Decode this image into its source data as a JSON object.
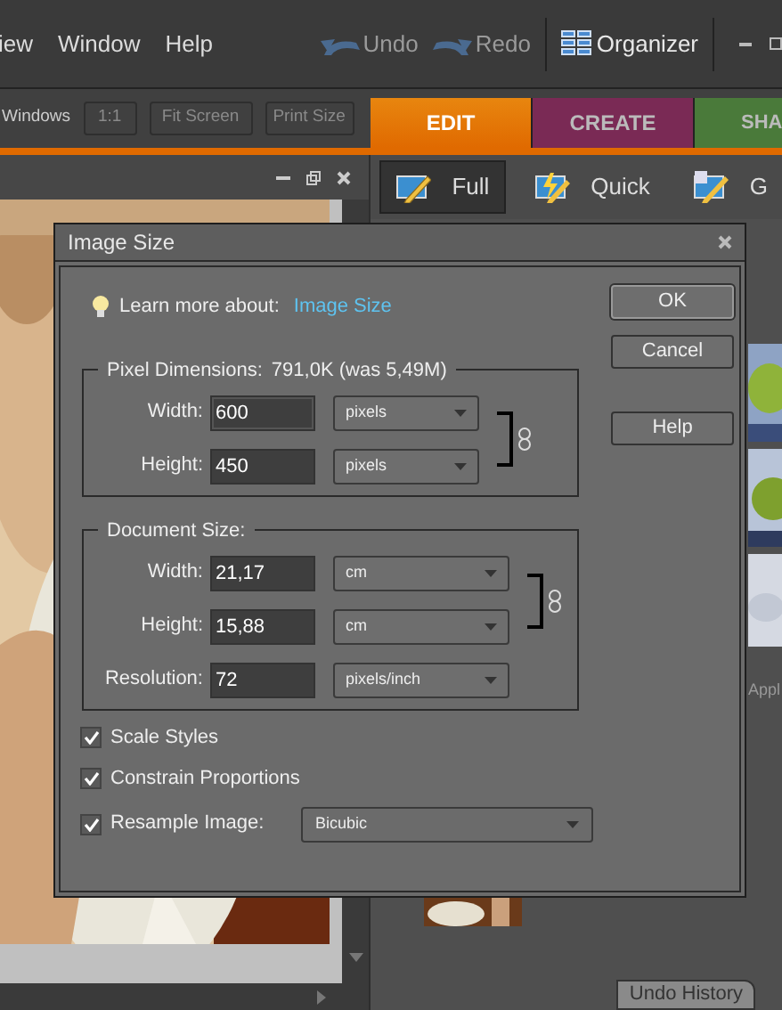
{
  "menu": [
    "iew",
    "Window",
    "Help"
  ],
  "toolbar": [
    {
      "kind": "undo",
      "label": "Undo"
    },
    {
      "kind": "redo",
      "label": "Redo"
    },
    {
      "kind": "organizer",
      "label": "Organizer"
    }
  ],
  "view_bar": {
    "label": "Windows",
    "buttons": [
      "1:1",
      "Fit Screen",
      "Print Size"
    ]
  },
  "mode_tabs": [
    {
      "label": "EDIT",
      "selected": true,
      "color": "#e8860f"
    },
    {
      "label": "CREATE",
      "selected": false,
      "color": "#7a2a55"
    },
    {
      "label": "SHA",
      "selected": false,
      "color": "#4a7a3a"
    }
  ],
  "edit_modes": [
    {
      "label": "Full",
      "selected": true
    },
    {
      "label": "Quick",
      "selected": false
    },
    {
      "label": "G",
      "selected": false
    }
  ],
  "panel": {
    "cut_label": "Appl",
    "tab": "Undo History"
  },
  "dialog": {
    "title": "Image Size",
    "learn_more": "Learn more about:",
    "link": "Image Size",
    "buttons": [
      "OK",
      "Cancel",
      "Help"
    ],
    "pixel_dimensions": {
      "label": "Pixel Dimensions:",
      "value": "791,0K (was 5,49M)",
      "fields": [
        {
          "label": "Width:",
          "value": "600",
          "unit": "pixels",
          "focused": true
        },
        {
          "label": "Height:",
          "value": "450",
          "unit": "pixels",
          "focused": false
        }
      ]
    },
    "document_size": {
      "label": "Document Size:",
      "fields": [
        {
          "label": "Width:",
          "value": "21,17",
          "unit": "cm"
        },
        {
          "label": "Height:",
          "value": "15,88",
          "unit": "cm"
        },
        {
          "label": "Resolution:",
          "value": "72",
          "unit": "pixels/inch"
        }
      ]
    },
    "options": [
      {
        "label": "Scale Styles",
        "checked": true
      },
      {
        "label": "Constrain Proportions",
        "checked": true
      },
      {
        "label": "Resample Image:",
        "checked": true,
        "select": "Bicubic"
      }
    ]
  }
}
